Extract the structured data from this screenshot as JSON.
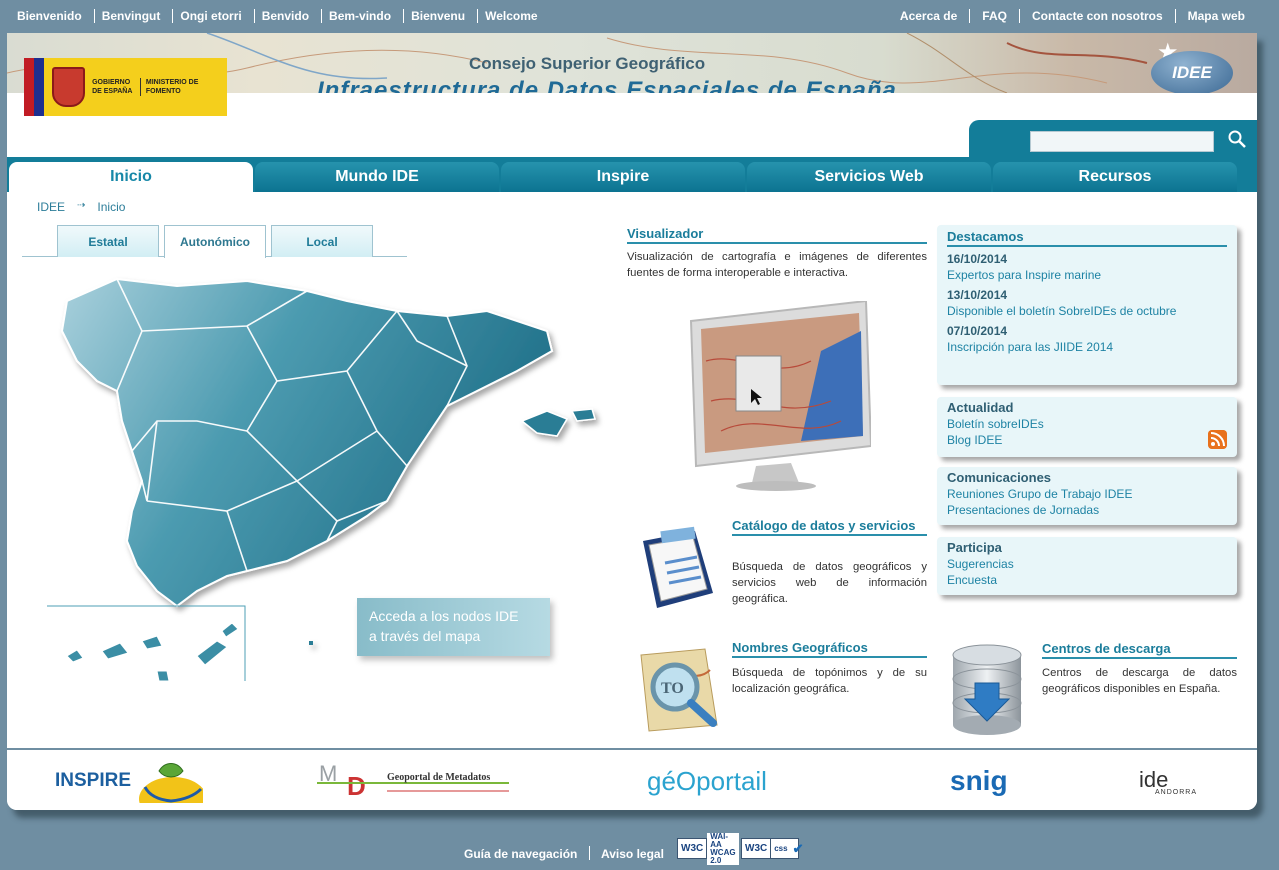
{
  "top": {
    "languages": [
      "Bienvenido",
      "Benvingut",
      "Ongi etorri",
      "Benvido",
      "Bem-vindo",
      "Bienvenu",
      "Welcome"
    ],
    "links": [
      "Acerca de",
      "FAQ",
      "Contacte con nosotros",
      "Mapa web"
    ]
  },
  "banner": {
    "title": "Consejo Superior Geográfico",
    "subtitle": "Infraestructura de Datos Espaciales de España",
    "gov_line1": "GOBIERNO DE ESPAÑA",
    "gov_line2": "MINISTERIO DE FOMENTO",
    "logo": "IDEE"
  },
  "search": {
    "value": "",
    "placeholder": ""
  },
  "nav": {
    "tabs": [
      "Inicio",
      "Mundo IDE",
      "Inspire",
      "Servicios Web",
      "Recursos"
    ],
    "active": "Inicio"
  },
  "breadcrumb": {
    "root": "IDEE",
    "current": "Inicio"
  },
  "map_tabs": {
    "items": [
      "Estatal",
      "Autonómico",
      "Local"
    ],
    "active": "Autonómico"
  },
  "map_button": {
    "line1": "Acceda a los nodos IDE",
    "line2": "a través del mapa"
  },
  "visualizador": {
    "title": "Visualizador",
    "text": "Visualización de cartografía e imágenes de diferentes fuentes de forma interoperable e interactiva."
  },
  "catalogo": {
    "title": "Catálogo de datos y servicios",
    "text": "Búsqueda de datos geográficos y servicios web de información geográfica."
  },
  "nombres": {
    "title": "Nombres Geográficos",
    "text": "Búsqueda de topónimos y de su localización geográfica."
  },
  "centros": {
    "title": "Centros de descarga",
    "text": "Centros de descarga de datos geográficos disponibles en España."
  },
  "destacamos": {
    "title": "Destacamos",
    "items": [
      {
        "date": "16/10/2014",
        "text": "Expertos para Inspire marine"
      },
      {
        "date": "13/10/2014",
        "text": "Disponible el boletín SobreIDEs de octubre"
      },
      {
        "date": "07/10/2014",
        "text": "Inscripción para las JIIDE 2014"
      }
    ]
  },
  "actualidad": {
    "title": "Actualidad",
    "links": [
      "Boletín sobreIDEs",
      "Blog IDEE"
    ]
  },
  "comunicaciones": {
    "title": "Comunicaciones",
    "links": [
      "Reuniones Grupo de Trabajo IDEE",
      "Presentaciones de Jornadas"
    ]
  },
  "participa": {
    "title": "Participa",
    "links": [
      "Sugerencias",
      "Encuesta"
    ]
  },
  "partners": {
    "inspire": "INSPIRE",
    "metadatos": "Geoportal de Metadatos",
    "geoportail": "géOportail",
    "snig": "snig",
    "andorra": "ide",
    "andorra_sub": "ANDORRA"
  },
  "footer": {
    "links": [
      "Guía de navegación",
      "Aviso legal"
    ],
    "badge1": "WAI-AA WCAG 2.0",
    "badge2": "css"
  },
  "colors": {
    "teal": "#137d99",
    "bg": "#6f8ea2",
    "accent_link": "#1e83a4"
  }
}
